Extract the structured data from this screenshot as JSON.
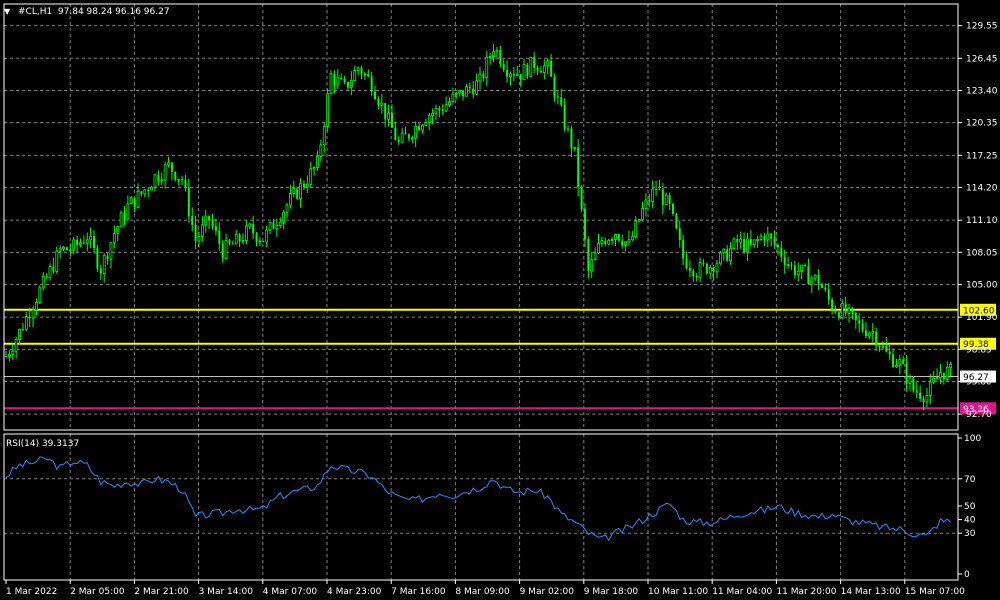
{
  "header": {
    "menu_arrow": "▼",
    "symbol_line": "#CL,H1  97.84 98.24 96.16 96.27"
  },
  "indicator": {
    "label": "RSI(14) 39.3137"
  },
  "colors": {
    "background": "#000000",
    "bull_candle": "#00ff00",
    "grid": "#7f7f7f",
    "level_line": "#ffff00",
    "bid_line": "#c0c0c0",
    "low_line": "#e0148c",
    "rsi_line": "#1e90ff",
    "axis_text": "#ffffff"
  },
  "chart_data": [
    {
      "type": "candlestick",
      "symbol": "#CL",
      "timeframe": "H1",
      "ohlc_last": {
        "open": 97.84,
        "high": 98.24,
        "low": 96.16,
        "close": 96.27
      },
      "ylim": [
        91.2,
        131.6
      ],
      "y_ticks": [
        "129.55",
        "126.45",
        "123.40",
        "120.35",
        "117.25",
        "114.20",
        "111.10",
        "108.05",
        "105.00",
        "101.90",
        "98.85",
        "95.80",
        "92.70"
      ],
      "x_ticks": [
        "1 Mar 2022",
        "2 Mar 05:00",
        "2 Mar 21:00",
        "3 Mar 14:00",
        "4 Mar 07:00",
        "4 Mar 23:00",
        "7 Mar 16:00",
        "8 Mar 09:00",
        "9 Mar 02:00",
        "9 Mar 18:00",
        "10 Mar 11:00",
        "11 Mar 04:00",
        "11 Mar 20:00",
        "14 Mar 13:00",
        "15 Mar 07:00"
      ],
      "price_levels": [
        {
          "value": "102.60",
          "role": "level",
          "color": "#ffff00"
        },
        {
          "value": "99.38",
          "role": "level",
          "color": "#ffff00"
        },
        {
          "value": "96.27",
          "role": "bid",
          "color": "#c0c0c0"
        },
        {
          "value": "93.26",
          "role": "low",
          "color": "#e0148c"
        }
      ],
      "close_path": [
        [
          0,
          98.2
        ],
        [
          4,
          100.5
        ],
        [
          8,
          103.2
        ],
        [
          12,
          105.6
        ],
        [
          16,
          108.2
        ],
        [
          20,
          108.5
        ],
        [
          24,
          109.6
        ],
        [
          28,
          106.5
        ],
        [
          32,
          109.9
        ],
        [
          36,
          112.4
        ],
        [
          40,
          113.6
        ],
        [
          44,
          115.2
        ],
        [
          48,
          116.2
        ],
        [
          52,
          115.0
        ],
        [
          56,
          109.2
        ],
        [
          60,
          111.2
        ],
        [
          64,
          108.2
        ],
        [
          68,
          109.0
        ],
        [
          72,
          110.2
        ],
        [
          76,
          109.3
        ],
        [
          80,
          111.2
        ],
        [
          84,
          113.0
        ],
        [
          88,
          114.6
        ],
        [
          92,
          116.4
        ],
        [
          96,
          124.8
        ],
        [
          100,
          123.6
        ],
        [
          104,
          125.6
        ],
        [
          108,
          124.1
        ],
        [
          112,
          121.2
        ],
        [
          116,
          118.3
        ],
        [
          120,
          119.6
        ],
        [
          124,
          121.0
        ],
        [
          128,
          121.6
        ],
        [
          132,
          122.6
        ],
        [
          136,
          123.4
        ],
        [
          140,
          124.2
        ],
        [
          144,
          127.6
        ],
        [
          148,
          125.5
        ],
        [
          152,
          125.0
        ],
        [
          156,
          126.0
        ],
        [
          160,
          125.5
        ],
        [
          164,
          121.3
        ],
        [
          168,
          117.3
        ],
        [
          172,
          106.2
        ],
        [
          176,
          109.2
        ],
        [
          180,
          110.0
        ],
        [
          184,
          108.7
        ],
        [
          188,
          112.0
        ],
        [
          192,
          114.2
        ],
        [
          196,
          112.2
        ],
        [
          200,
          107.5
        ],
        [
          204,
          106.3
        ],
        [
          208,
          106.8
        ],
        [
          212,
          107.6
        ],
        [
          216,
          109.0
        ],
        [
          220,
          108.5
        ],
        [
          224,
          109.8
        ],
        [
          228,
          108.4
        ],
        [
          232,
          106.6
        ],
        [
          236,
          106.0
        ],
        [
          240,
          105.3
        ],
        [
          244,
          102.9
        ],
        [
          248,
          102.3
        ],
        [
          252,
          101.0
        ],
        [
          256,
          100.5
        ],
        [
          260,
          98.4
        ],
        [
          264,
          97.5
        ],
        [
          268,
          95.0
        ],
        [
          272,
          94.5
        ],
        [
          276,
          96.7
        ]
      ]
    },
    {
      "type": "line",
      "name": "RSI(14)",
      "value": 39.3137,
      "ylim": [
        0,
        100
      ],
      "y_ticks": [
        "100",
        "70",
        "50",
        "40",
        "30",
        "0"
      ],
      "x": [
        0,
        4,
        8,
        12,
        16,
        20,
        24,
        28,
        32,
        36,
        40,
        44,
        48,
        52,
        56,
        60,
        64,
        68,
        72,
        76,
        80,
        84,
        88,
        92,
        96,
        100,
        104,
        108,
        112,
        116,
        120,
        124,
        128,
        132,
        136,
        140,
        144,
        148,
        152,
        156,
        160,
        164,
        168,
        172,
        176,
        180,
        184,
        188,
        192,
        196,
        200,
        204,
        208,
        212,
        216,
        220,
        224,
        228,
        232,
        236,
        240,
        244,
        248,
        252,
        256,
        260,
        264,
        268,
        272,
        276
      ],
      "values": [
        72,
        80,
        82,
        85,
        78,
        83,
        80,
        68,
        65,
        68,
        66,
        70,
        68,
        62,
        42,
        44,
        45,
        48,
        47,
        48,
        56,
        60,
        62,
        65,
        80,
        77,
        75,
        72,
        62,
        56,
        54,
        56,
        60,
        58,
        61,
        64,
        70,
        62,
        60,
        62,
        57,
        44,
        38,
        30,
        25,
        30,
        34,
        40,
        46,
        52,
        40,
        38,
        38,
        40,
        44,
        46,
        47,
        50,
        46,
        44,
        42,
        44,
        40,
        38,
        36,
        34,
        33,
        30,
        28,
        39
      ]
    }
  ]
}
